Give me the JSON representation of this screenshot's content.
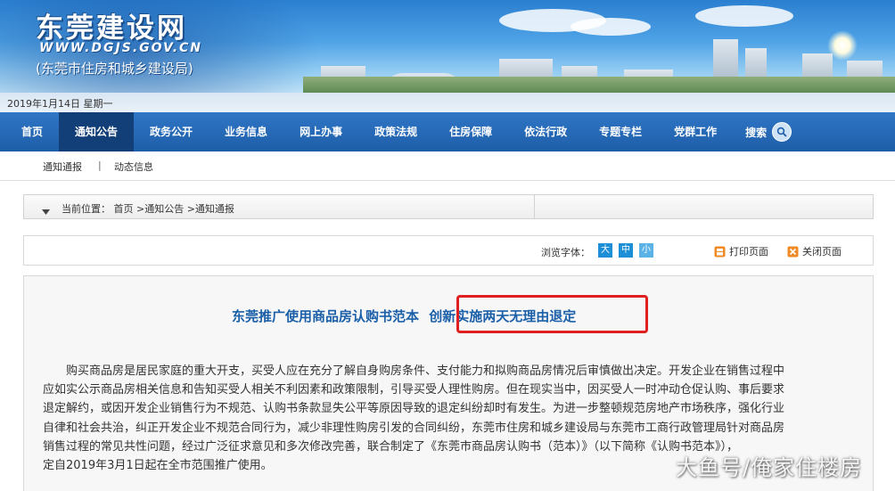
{
  "header": {
    "site_title": "东莞建设网",
    "site_url": "WWW.DGJS.GOV.CN",
    "site_subtitle": "(东莞市住房和城乡建设局)",
    "date": "2019年1月14日  星期一"
  },
  "nav": {
    "items": [
      {
        "label": "首页",
        "active": false
      },
      {
        "label": "通知公告",
        "active": true
      },
      {
        "label": "政务公开",
        "active": false
      },
      {
        "label": "业务信息",
        "active": false
      },
      {
        "label": "网上办事",
        "active": false
      },
      {
        "label": "政策法规",
        "active": false
      },
      {
        "label": "住房保障",
        "active": false
      },
      {
        "label": "依法行政",
        "active": false
      },
      {
        "label": "专题专栏",
        "active": false
      },
      {
        "label": "党群工作",
        "active": false
      }
    ],
    "search_label": "搜索"
  },
  "subnav": {
    "items": [
      "通知通报",
      "动态信息"
    ],
    "separator": "|"
  },
  "breadcrumb": {
    "text": "当前位置： 首页 >通知公告 >通知通报"
  },
  "tools": {
    "font_size_label": "浏览字体：",
    "sizes": [
      "大",
      "中",
      "小"
    ],
    "print_label": "打印页面",
    "close_label": "关闭页面"
  },
  "article": {
    "title_main": "东莞推广使用商品房认购书范本",
    "title_highlight": "创新实施两天无理由退定",
    "lines": [
      "购买商品房是居民家庭的重大开支，买受人应在充分了解自身购房条件、支付能力和拟购商品房情况后审慎做出决定。开发企业在销售过程中",
      "应如实公示商品房相关信息和告知买受人相关不利因素和政策限制，引导买受人理性购房。但在现实当中，因买受人一时冲动仓促认购、事后要求",
      "退定解约，或因开发企业销售行为不规范、认购书条款显失公平等原因导致的退定纠纷却时有发生。为进一步整顿规范房地产市场秩序，强化行业",
      "自律和社会共治，纠正开发企业不规范合同行为，减少非理性购房引发的合同纠纷，东莞市住房和城乡建设局与东莞市工商行政管理局针对商品房",
      "销售过程的常见共性问题，经过广泛征求意见和多次修改完善，联合制定了《东莞市商品房认购书（范本）》（以下简称《认购书范本》），",
      "定自2019年3月1日起在全市范围推广使用。"
    ]
  },
  "watermark": "大鱼号/俺家住楼房",
  "colors": {
    "nav_bg": "#1e5ea8",
    "nav_active": "#123f78",
    "headline": "#1a5fa8",
    "highlight_border": "#e02020",
    "size_button": "#1c8fd6"
  }
}
